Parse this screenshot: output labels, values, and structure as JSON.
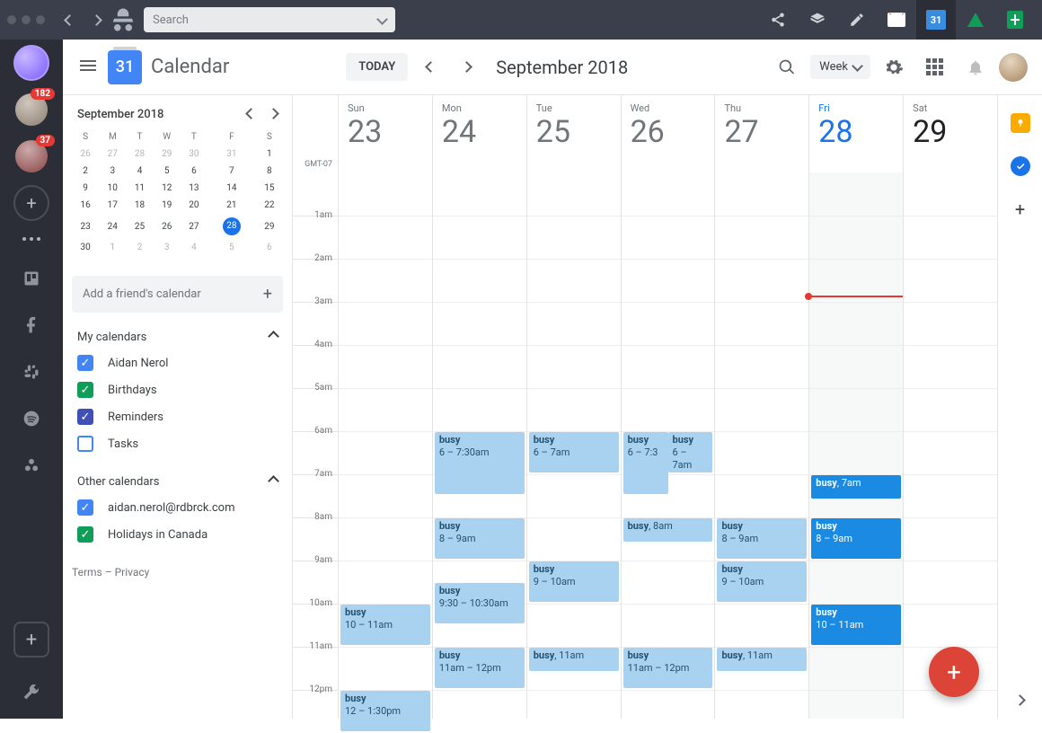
{
  "titlebar": {
    "search_placeholder": "Search"
  },
  "leftrail": {
    "badge1": "182",
    "badge2": "37"
  },
  "appbar": {
    "logo_day": "31",
    "title": "Calendar",
    "today": "TODAY",
    "month": "September 2018",
    "view": "Week"
  },
  "mini": {
    "title": "September 2018",
    "dow": [
      "S",
      "M",
      "T",
      "W",
      "T",
      "F",
      "S"
    ],
    "rows": [
      [
        {
          "d": "26",
          "g": 1
        },
        {
          "d": "27",
          "g": 1
        },
        {
          "d": "28",
          "g": 1
        },
        {
          "d": "29",
          "g": 1
        },
        {
          "d": "30",
          "g": 1
        },
        {
          "d": "31",
          "g": 1
        },
        {
          "d": "1"
        }
      ],
      [
        {
          "d": "2"
        },
        {
          "d": "3"
        },
        {
          "d": "4"
        },
        {
          "d": "5"
        },
        {
          "d": "6"
        },
        {
          "d": "7"
        },
        {
          "d": "8"
        }
      ],
      [
        {
          "d": "9"
        },
        {
          "d": "10"
        },
        {
          "d": "11"
        },
        {
          "d": "12"
        },
        {
          "d": "13"
        },
        {
          "d": "14"
        },
        {
          "d": "15"
        }
      ],
      [
        {
          "d": "16"
        },
        {
          "d": "17"
        },
        {
          "d": "18"
        },
        {
          "d": "19"
        },
        {
          "d": "20"
        },
        {
          "d": "21"
        },
        {
          "d": "22"
        }
      ],
      [
        {
          "d": "23"
        },
        {
          "d": "24"
        },
        {
          "d": "25"
        },
        {
          "d": "26"
        },
        {
          "d": "27"
        },
        {
          "d": "28",
          "t": 1
        },
        {
          "d": "29"
        }
      ],
      [
        {
          "d": "30"
        },
        {
          "d": "1",
          "g": 1
        },
        {
          "d": "2",
          "g": 1
        },
        {
          "d": "3",
          "g": 1
        },
        {
          "d": "4",
          "g": 1
        },
        {
          "d": "5",
          "g": 1
        },
        {
          "d": "6",
          "g": 1
        }
      ]
    ]
  },
  "side": {
    "add_friend": "Add a friend's calendar",
    "my_calendars": "My calendars",
    "other_calendars": "Other calendars",
    "cal1": "Aidan Nerol",
    "cal2": "Birthdays",
    "cal3": "Reminders",
    "cal4": "Tasks",
    "ocal1": "aidan.nerol@rdbrck.com",
    "ocal2": "Holidays in Canada",
    "terms": "Terms",
    "privacy": "Privacy",
    "dash": "–"
  },
  "grid": {
    "tz": "GMT-07",
    "days": [
      {
        "n": "Sun",
        "d": "23"
      },
      {
        "n": "Mon",
        "d": "24"
      },
      {
        "n": "Tue",
        "d": "25"
      },
      {
        "n": "Wed",
        "d": "26"
      },
      {
        "n": "Thu",
        "d": "27"
      },
      {
        "n": "Fri",
        "d": "28"
      },
      {
        "n": "Sat",
        "d": "29"
      }
    ],
    "hours": [
      "1am",
      "2am",
      "3am",
      "4am",
      "5am",
      "6am",
      "7am",
      "8am",
      "9am",
      "10am",
      "11am",
      "12pm"
    ]
  },
  "ev": {
    "busy": "busy",
    "mon_6": "6 – 7:30am",
    "tue_6": "6 – 7am",
    "wed_6": "6 – 7:3",
    "wed_6b": "6 – 7am",
    "mon_8": "8 – 9am",
    "wed_8": ", 8am",
    "thu_8": "8 – 9am",
    "fri_7": ", 7am",
    "fri_8": "8 – 9am",
    "tue_9": "9 – 10am",
    "thu_9": "9 – 10am",
    "mon_930": "9:30 – 10:30am",
    "sun_10": "10 – 11am",
    "fri_10": "10 – 11am",
    "mon_11": "11am – 12pm",
    "tue_11": ", 11am",
    "wed_11": "11am – 12pm",
    "thu_11": ", 11am",
    "sun_12": "12 – 1:30pm"
  }
}
